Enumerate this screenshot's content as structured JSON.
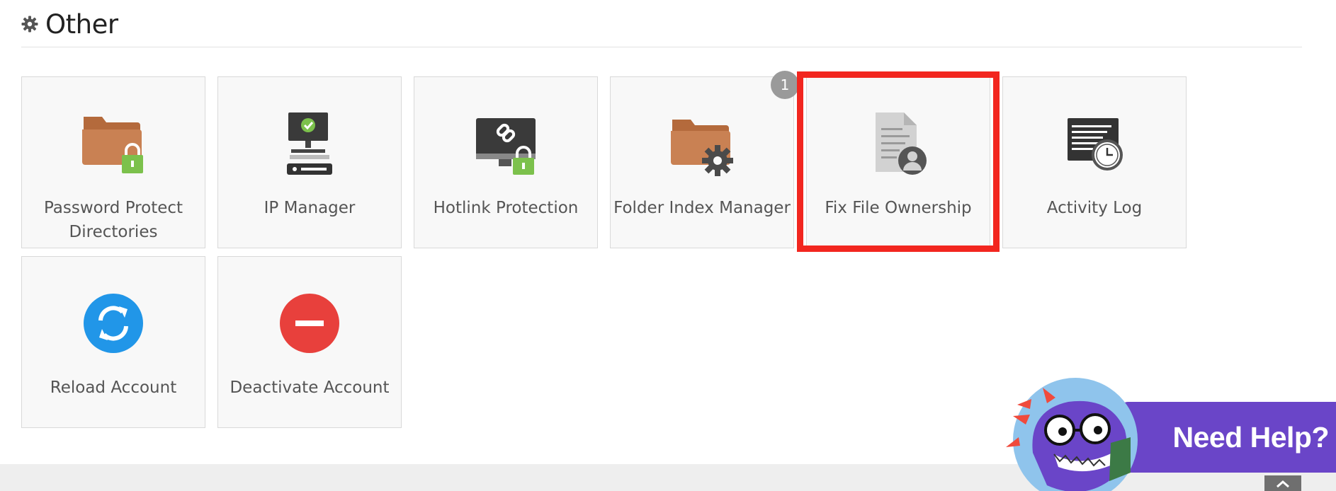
{
  "section": {
    "title": "Other",
    "icon": "gear-icon"
  },
  "tiles": [
    {
      "label": "Password Protect Directories",
      "icon": "folder-lock-icon"
    },
    {
      "label": "IP Manager",
      "icon": "ip-manager-icon"
    },
    {
      "label": "Hotlink Protection",
      "icon": "monitor-link-lock-icon"
    },
    {
      "label": "Folder Index Manager",
      "icon": "folder-gear-icon"
    },
    {
      "label": "Fix File Ownership",
      "icon": "file-user-icon"
    },
    {
      "label": "Activity Log",
      "icon": "log-clock-icon"
    },
    {
      "label": "Reload Account",
      "icon": "reload-icon"
    },
    {
      "label": "Deactivate Account",
      "icon": "deactivate-icon"
    }
  ],
  "step_badge": "1",
  "help": {
    "label": "Need Help?"
  },
  "colors": {
    "highlight": "#f2261f",
    "folder": "#c98153",
    "lock": "#7cc14c",
    "reload": "#2196e8",
    "deactivate": "#e8403c",
    "help_banner": "#6a45c8"
  }
}
